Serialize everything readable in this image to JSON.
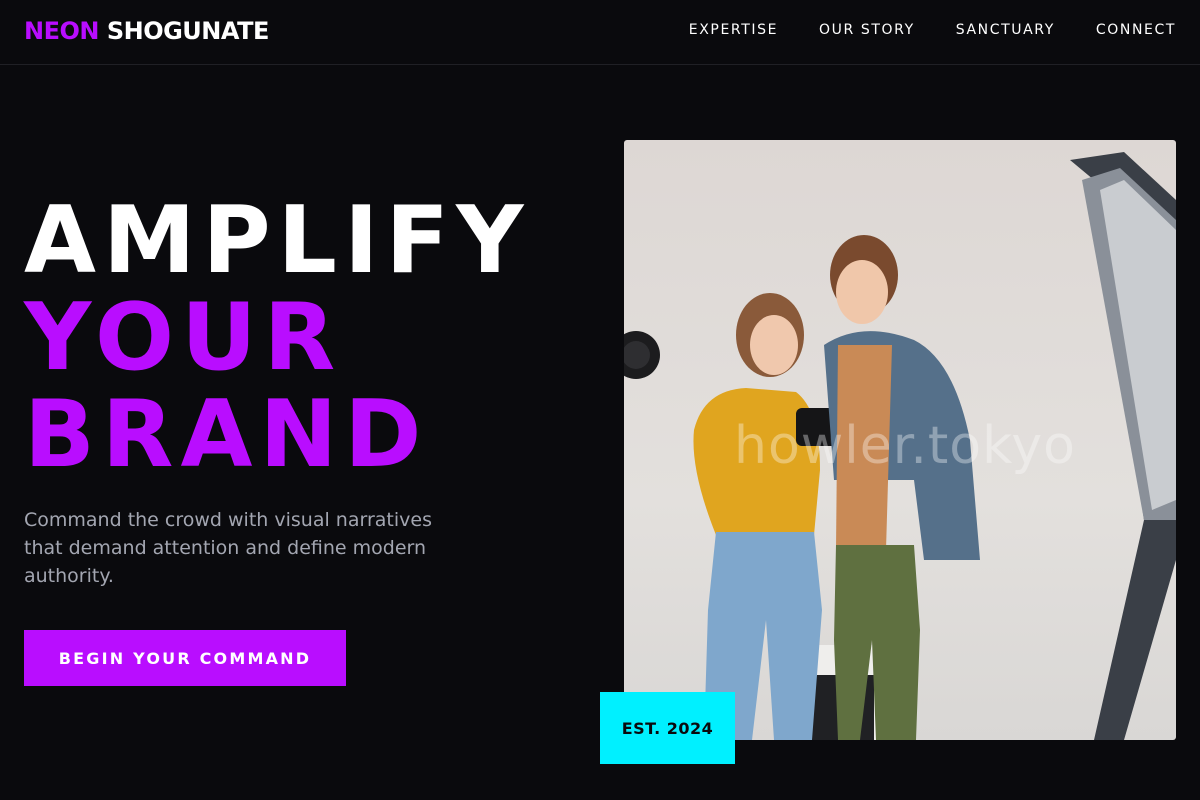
{
  "header": {
    "logo_accent": "NEON",
    "logo_rest": "SHOGUNATE",
    "nav": [
      "EXPERTISE",
      "OUR STORY",
      "SANCTUARY",
      "CONNECT"
    ]
  },
  "hero": {
    "headline": [
      "AMPLIFY",
      "YOUR",
      "BRAND"
    ],
    "subtext": "Command the crowd with visual narratives that demand attention and define modern authority.",
    "cta_label": "BEGIN YOUR COMMAND",
    "image_watermark": "howler.tokyo",
    "badge": "EST. 2024"
  },
  "colors": {
    "background": "#0a0a0d",
    "accent_purple": "#b90dff",
    "accent_cyan": "#00f0ff",
    "muted_text": "#a3a6b1"
  }
}
